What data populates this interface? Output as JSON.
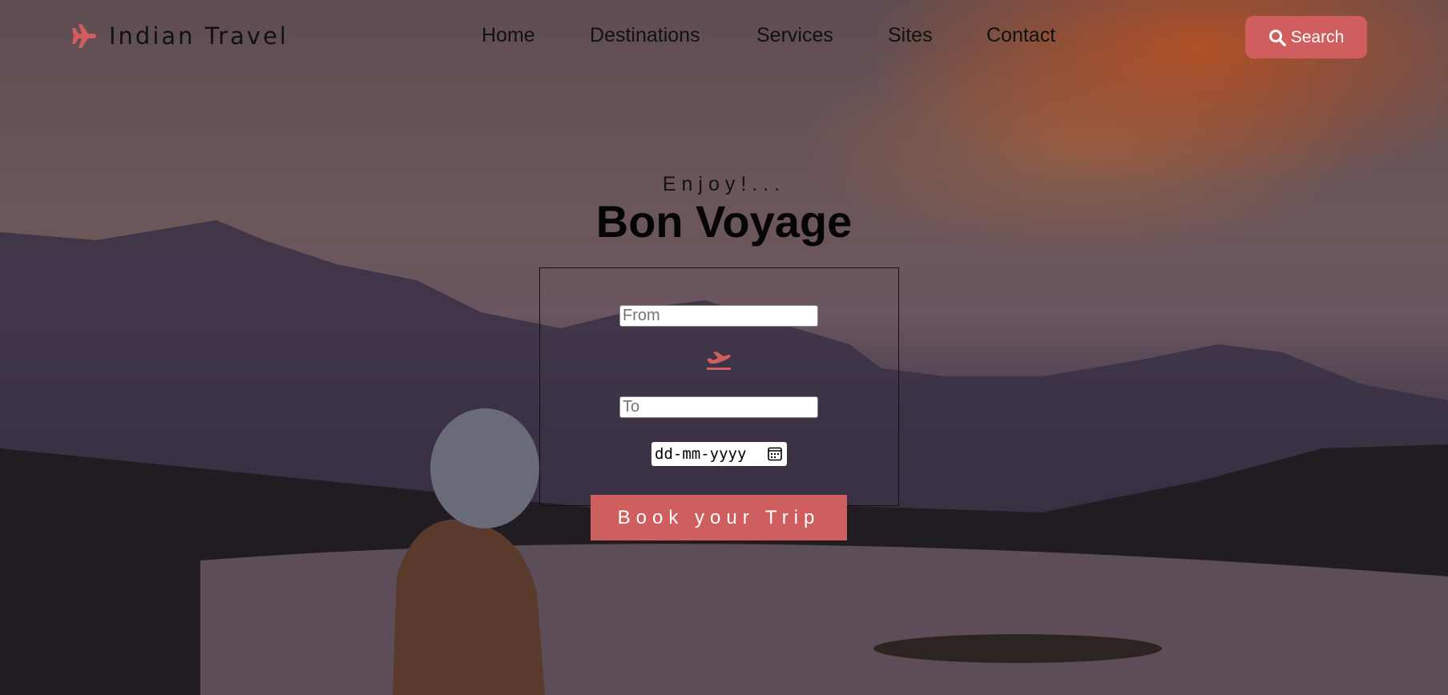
{
  "brand": {
    "name": "Indian Travel",
    "accent": "#d05e5e"
  },
  "nav": {
    "items": [
      "Home",
      "Destinations",
      "Services",
      "Sites",
      "Contact"
    ],
    "search_label": "Search"
  },
  "hero": {
    "kicker": "Enjoy!...",
    "title": "Bon Voyage"
  },
  "form": {
    "from_placeholder": "From",
    "to_placeholder": "To",
    "date_placeholder": "dd-mm-yyyy",
    "submit_label": "Book your Trip"
  }
}
